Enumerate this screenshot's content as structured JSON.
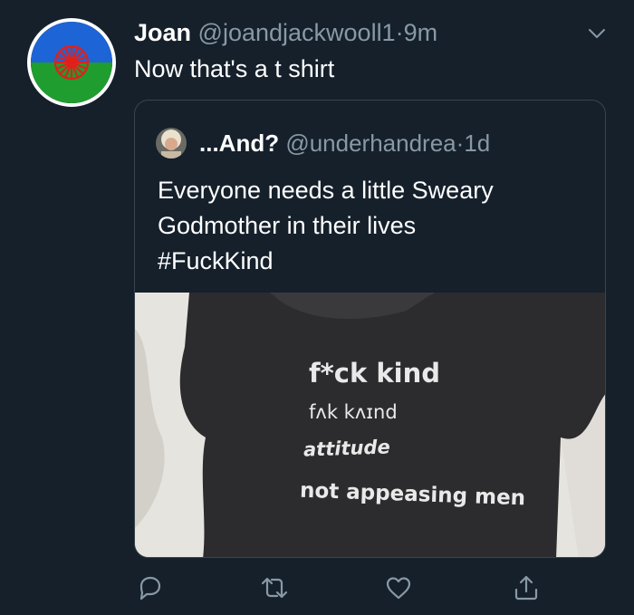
{
  "tweet": {
    "display_name": "Joan",
    "handle": "@joandjackwooll1",
    "separator": "·",
    "time": "9m",
    "text": "Now that's a t shirt",
    "avatar_icon": "romani-flag-avatar"
  },
  "quoted_tweet": {
    "display_name": "...And?",
    "handle": "@underhandrea",
    "separator": "·",
    "time": "1d",
    "text_lines": [
      "Everyone needs a little Sweary",
      "Godmother in their lives",
      "#FuckKind"
    ],
    "media": {
      "line1": "f*ck kind",
      "line2": "fʌk kʌɪnd",
      "line3": "attitude",
      "line4": "not appeasing men"
    }
  },
  "actions": {
    "reply_icon": "reply-icon",
    "retweet_icon": "retweet-icon",
    "like_icon": "heart-icon",
    "share_icon": "share-icon"
  },
  "colors": {
    "background": "#15202b",
    "muted": "#8899a6",
    "border": "#38444d"
  }
}
